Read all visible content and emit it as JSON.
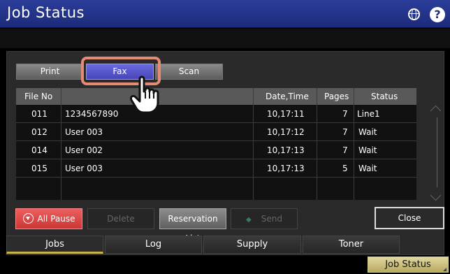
{
  "window": {
    "title": "Job Status"
  },
  "job_type_tabs": [
    {
      "label": "Print",
      "active": false
    },
    {
      "label": "Fax",
      "active": true
    },
    {
      "label": "Scan",
      "active": false
    }
  ],
  "table": {
    "columns": [
      "File No",
      "",
      "Date,Time",
      "Pages",
      "Status"
    ],
    "rows": [
      {
        "file_no": "011",
        "name": "1234567890",
        "date_time": "10,17:11",
        "pages": "7",
        "status": "Line1"
      },
      {
        "file_no": "012",
        "name": "User 003",
        "date_time": "10,17:12",
        "pages": "7",
        "status": "Wait"
      },
      {
        "file_no": "014",
        "name": "User 002",
        "date_time": "10,17:13",
        "pages": "7",
        "status": "Wait"
      },
      {
        "file_no": "015",
        "name": "User 003",
        "date_time": "10,17:13",
        "pages": "5",
        "status": "Wait"
      }
    ]
  },
  "actions": {
    "all_pause": "All Pause",
    "delete": "Delete",
    "reservation_list": "Reservation List",
    "send": "Send",
    "close": "Close"
  },
  "bottom_tabs": [
    {
      "label": "Jobs",
      "active": true
    },
    {
      "label": "Log",
      "active": false
    },
    {
      "label": "Supply",
      "active": false
    },
    {
      "label": "Toner",
      "active": false
    }
  ],
  "footer": {
    "job_status_button": "Job Status"
  },
  "colors": {
    "accent_blue": "#4646b8",
    "title_bar": "#1c2b7a",
    "pause_red": "#c93636",
    "highlight": "#e58a73",
    "tab_underline": "#c9b34a"
  },
  "icons": [
    "globe-icon",
    "help-icon",
    "stop-icon",
    "send-icon",
    "pointing-hand-icon"
  ]
}
